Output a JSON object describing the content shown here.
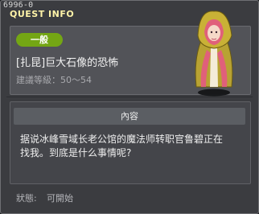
{
  "quest_id": "6996-0",
  "window": {
    "title": "QUEST INFO"
  },
  "quest": {
    "category_badge": "一般",
    "name": "[扎昆]巨大石像的恐怖",
    "level_label": "建議等級：",
    "level_range": "50〜54"
  },
  "content": {
    "header": "內容",
    "text": "据说冰峰雪域长老公馆的魔法师转职官鲁碧正在找我。到底是什么事情呢?"
  },
  "status": {
    "label": "狀態:",
    "value": "可開始"
  },
  "colors": {
    "badge": "#74a614",
    "title": "#fff3a8",
    "hood": "#b8a233",
    "hair": "#e0607a"
  },
  "icons": {
    "portrait": "hooded-npc-icon"
  }
}
